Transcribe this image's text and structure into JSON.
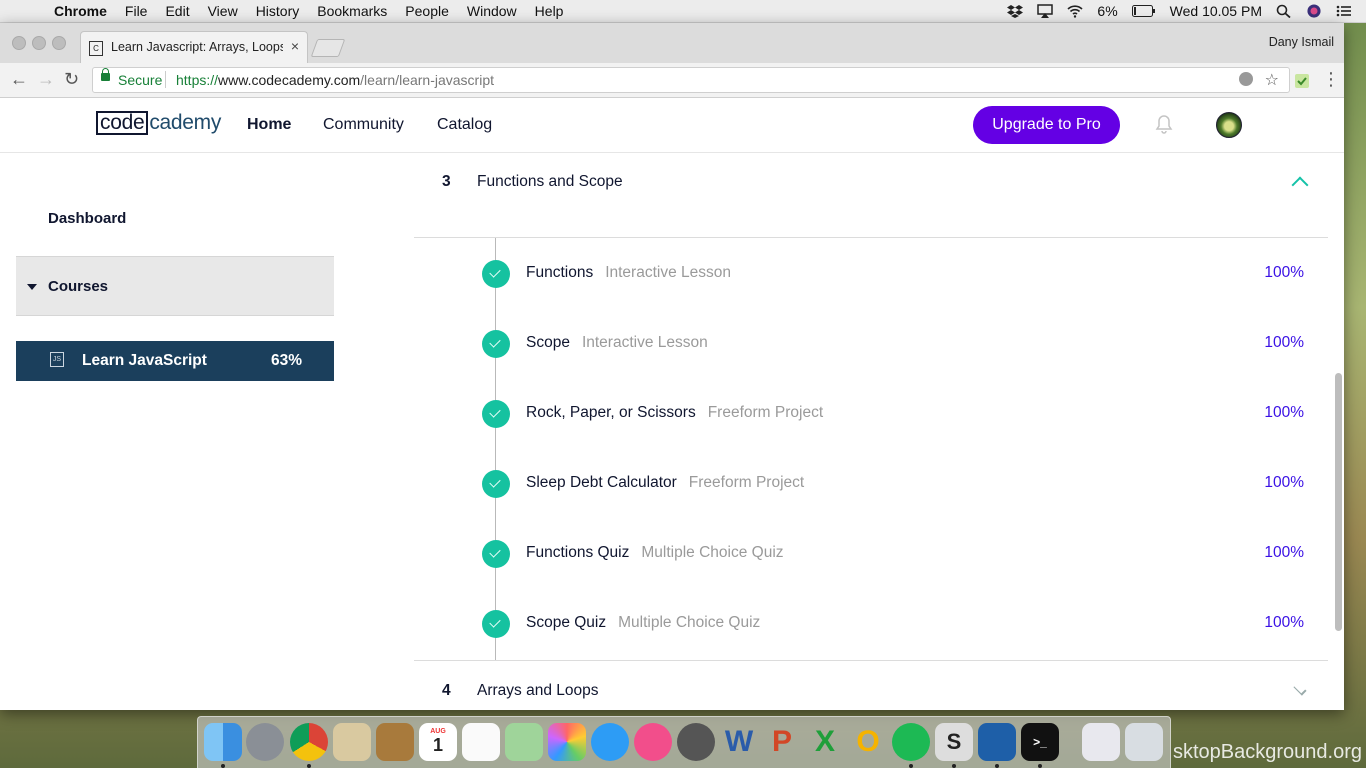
{
  "menubar": {
    "app": "Chrome",
    "items": [
      "File",
      "Edit",
      "View",
      "History",
      "Bookmarks",
      "People",
      "Window",
      "Help"
    ],
    "battery": "6%",
    "clock": "Wed 10.05 PM"
  },
  "browser": {
    "tab_title": "Learn Javascript: Arrays, Loops",
    "profile": "Dany Ismail",
    "secure_label": "Secure",
    "url_scheme": "https://",
    "url_host": "www.codecademy.com",
    "url_path": "/learn/learn-javascript"
  },
  "header": {
    "logo_boxed": "code",
    "logo_rest": "cademy",
    "nav": [
      "Home",
      "Community",
      "Catalog"
    ],
    "upgrade": "Upgrade to Pro"
  },
  "sidebar": {
    "dashboard": "Dashboard",
    "courses": "Courses",
    "course_icon": "JS",
    "course_name": "Learn JavaScript",
    "course_progress": "63%"
  },
  "syllabus": {
    "unit3": {
      "number": "3",
      "title": "Functions and Scope"
    },
    "lessons": [
      {
        "name": "Functions",
        "type": "Interactive Lesson",
        "progress": "100%"
      },
      {
        "name": "Scope",
        "type": "Interactive Lesson",
        "progress": "100%"
      },
      {
        "name": "Rock, Paper, or Scissors",
        "type": "Freeform Project",
        "progress": "100%"
      },
      {
        "name": "Sleep Debt Calculator",
        "type": "Freeform Project",
        "progress": "100%"
      },
      {
        "name": "Functions Quiz",
        "type": "Multiple Choice Quiz",
        "progress": "100%"
      },
      {
        "name": "Scope Quiz",
        "type": "Multiple Choice Quiz",
        "progress": "100%"
      }
    ],
    "unit4": {
      "number": "4",
      "title": "Arrays and Loops"
    }
  },
  "colors": {
    "brand_purple": "#6400e4",
    "check_green": "#15c2a0",
    "progress_blue": "#3a10e5",
    "sidebar_active": "#1b3f5c"
  },
  "dock": {
    "icons": [
      "finder-icon",
      "launchpad-icon",
      "chrome-icon",
      "mail-icon",
      "contacts-icon",
      "calendar-icon",
      "reminders-icon",
      "maps-icon",
      "photos-icon",
      "messages-icon",
      "itunes-icon",
      "system-preferences-icon",
      "word-icon",
      "powerpoint-icon",
      "excel-icon",
      "outlook-icon",
      "spotify-icon",
      "sublime-icon",
      "vscode-icon",
      "terminal-icon",
      "downloads-stack-icon",
      "trash-icon"
    ],
    "calendar_month": "AUG",
    "calendar_day": "1",
    "watermark": "sktopBackground.org"
  }
}
